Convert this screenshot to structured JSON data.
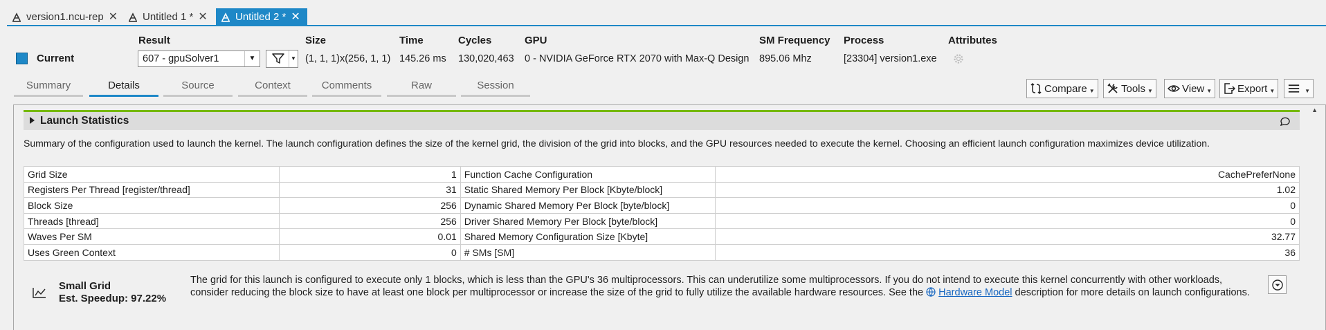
{
  "doc_tabs": [
    {
      "label": "version1.ncu-rep",
      "active": false
    },
    {
      "label": "Untitled 1 *",
      "active": false
    },
    {
      "label": "Untitled 2 *",
      "active": true
    }
  ],
  "header": {
    "labels": {
      "result": "Result",
      "size": "Size",
      "time": "Time",
      "cycles": "Cycles",
      "gpu": "GPU",
      "sm_frequency": "SM Frequency",
      "process": "Process",
      "attributes": "Attributes"
    },
    "current_label": "Current",
    "current_color": "#1e88c7",
    "result_value": "607 - gpuSolver1",
    "size_value": "(1, 1, 1)x(256, 1, 1)",
    "time_value": "145.26 ms",
    "cycles_value": "130,020,463",
    "gpu_value": "0 - NVIDIA GeForce RTX 2070 with Max-Q Design",
    "sm_frequency_value": "895.06 Mhz",
    "process_value": "[23304] version1.exe"
  },
  "view_tabs": [
    {
      "label": "Summary",
      "active": false
    },
    {
      "label": "Details",
      "active": true
    },
    {
      "label": "Source",
      "active": false
    },
    {
      "label": "Context",
      "active": false
    },
    {
      "label": "Comments",
      "active": false
    },
    {
      "label": "Raw",
      "active": false
    },
    {
      "label": "Session",
      "active": false
    }
  ],
  "toolbar": {
    "compare": "Compare",
    "tools": "Tools",
    "view": "View",
    "export": "Export"
  },
  "section": {
    "title": "Launch Statistics",
    "description": "Summary of the configuration used to launch the kernel. The launch configuration defines the size of the kernel grid, the division of the grid into blocks, and the GPU resources needed to execute the kernel. Choosing an efficient launch configuration maximizes device utilization.",
    "accent_color": "#76b900",
    "rows": [
      {
        "left_name": "Grid Size",
        "left_value": "1",
        "right_name": "Function Cache Configuration",
        "right_value": "CachePreferNone"
      },
      {
        "left_name": "Registers Per Thread [register/thread]",
        "left_value": "31",
        "right_name": "Static Shared Memory Per Block [Kbyte/block]",
        "right_value": "1.02"
      },
      {
        "left_name": "Block Size",
        "left_value": "256",
        "right_name": "Dynamic Shared Memory Per Block [byte/block]",
        "right_value": "0"
      },
      {
        "left_name": "Threads [thread]",
        "left_value": "256",
        "right_name": "Driver Shared Memory Per Block [byte/block]",
        "right_value": "0"
      },
      {
        "left_name": "Waves Per SM",
        "left_value": "0.01",
        "right_name": "Shared Memory Configuration Size [Kbyte]",
        "right_value": "32.77"
      },
      {
        "left_name": "Uses Green Context",
        "left_value": "0",
        "right_name": "# SMs [SM]",
        "right_value": "36"
      }
    ]
  },
  "rule": {
    "title": "Small Grid",
    "speedup": "Est. Speedup: 97.22%",
    "text_before": "The grid for this launch is configured to execute only 1 blocks, which is less than the GPU's 36 multiprocessors. This can underutilize some multiprocessors. If you do not intend to execute this kernel concurrently with other workloads, consider reducing the block size to have at least one block per multiprocessor or increase the size of the grid to fully utilize the available hardware resources. See the ",
    "link_text": "Hardware Model",
    "text_after": " description for more details on launch configurations."
  }
}
